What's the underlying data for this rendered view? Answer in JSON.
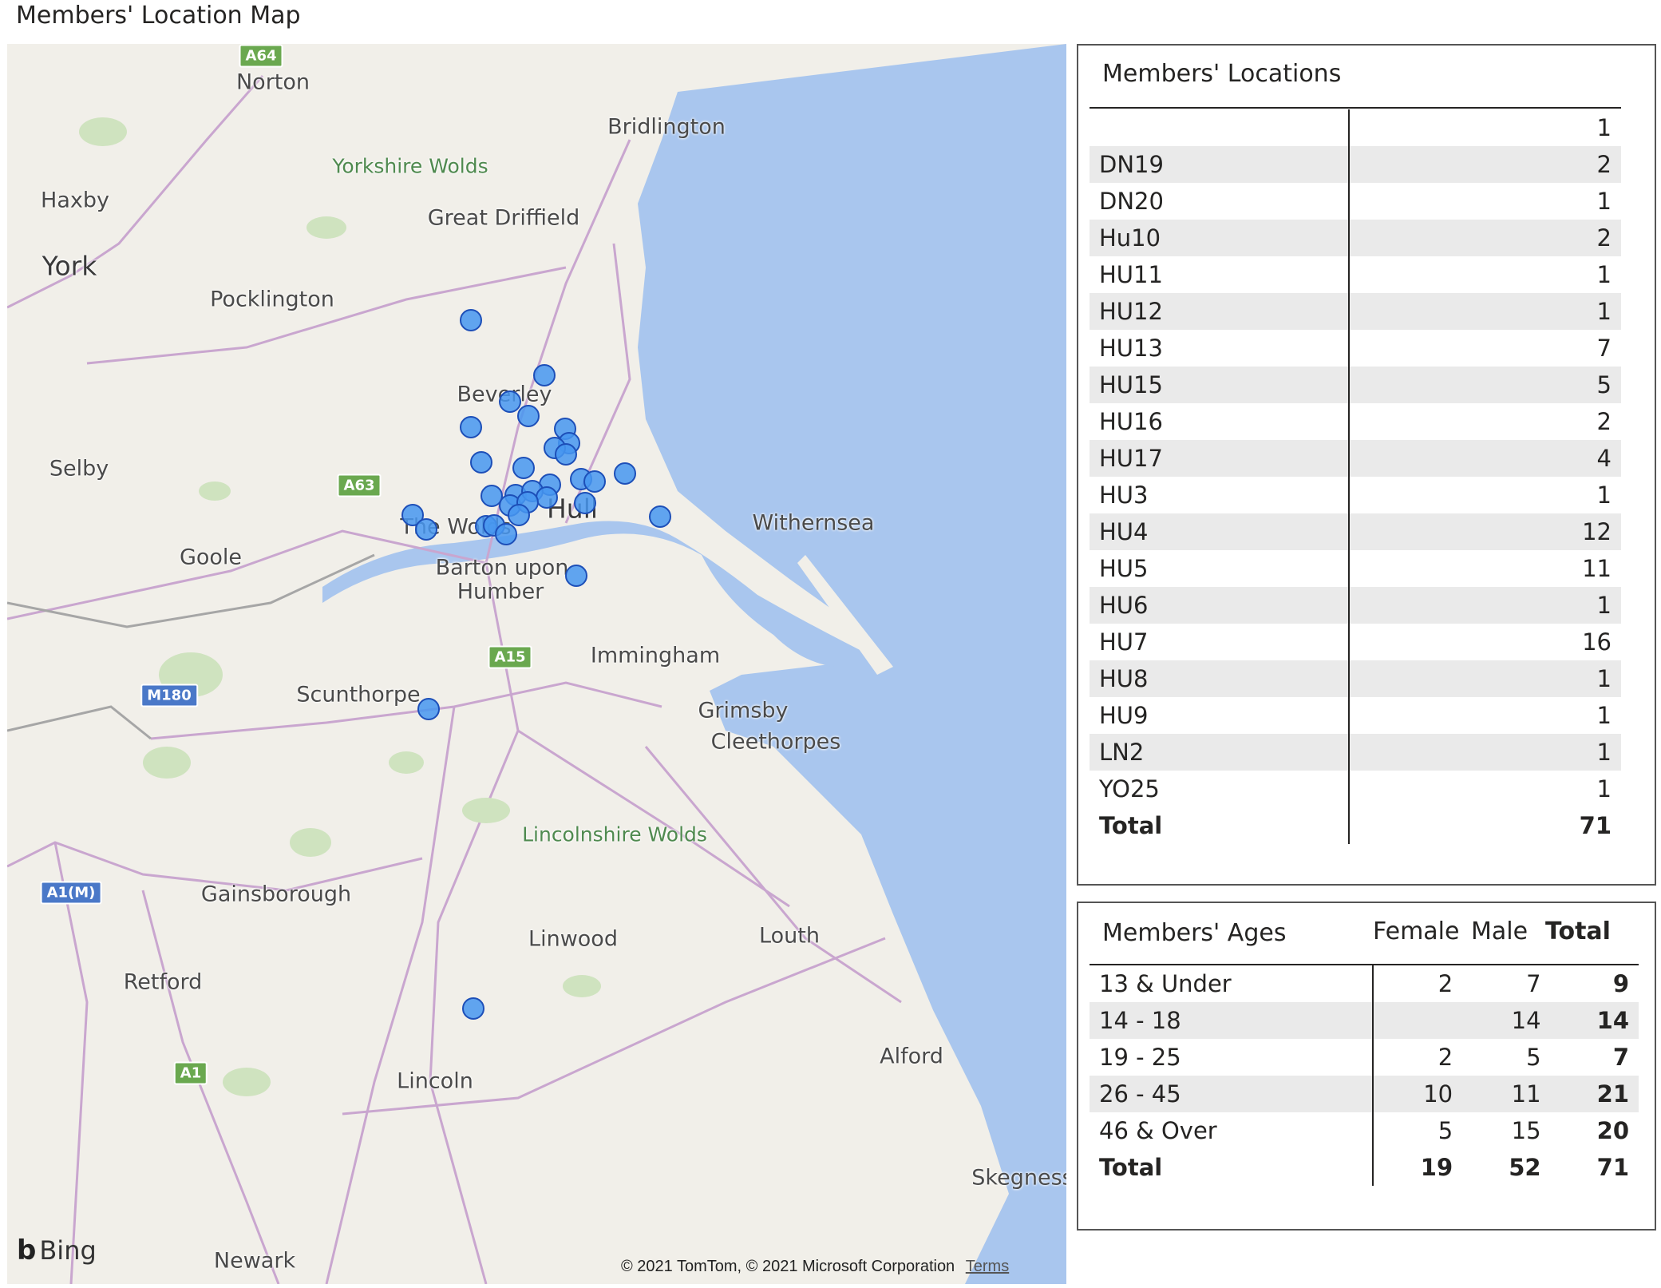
{
  "page_title": "Members' Location Map",
  "map": {
    "places": [
      "Norton",
      "Bridlington",
      "Yorkshire Wolds",
      "Haxby",
      "Great Driffield",
      "York",
      "Pocklington",
      "Beverley",
      "Selby",
      "Hull",
      "The Wolds",
      "Withernsea",
      "Goole",
      "Barton upon",
      "Humber",
      "Immingham",
      "Scunthorpe",
      "Grimsby",
      "Cleethorpes",
      "Lincolnshire Wolds",
      "Gainsborough",
      "Linwood",
      "Louth",
      "Retford",
      "Alford",
      "Lincoln",
      "Skegness",
      "Newark"
    ],
    "roads": [
      "A64",
      "A63",
      "A15",
      "M180",
      "A1(M)",
      "A1"
    ],
    "attribution_logo": "Bing",
    "copyright": "© 2021 TomTom, © 2021 Microsoft Corporation",
    "terms_link": "Terms",
    "marker_count_label": "",
    "colors": {
      "water": "#a9c6ee",
      "land": "#f1efe9",
      "marker": "#4696f0",
      "marker_border": "#1d4fb8"
    }
  },
  "locations_table": {
    "title": "Members' Locations",
    "rows": [
      {
        "code": "",
        "count": "1"
      },
      {
        "code": "DN19",
        "count": "2"
      },
      {
        "code": "DN20",
        "count": "1"
      },
      {
        "code": "Hu10",
        "count": "2"
      },
      {
        "code": "HU11",
        "count": "1"
      },
      {
        "code": "HU12",
        "count": "1"
      },
      {
        "code": "HU13",
        "count": "7"
      },
      {
        "code": "HU15",
        "count": "5"
      },
      {
        "code": "HU16",
        "count": "2"
      },
      {
        "code": "HU17",
        "count": "4"
      },
      {
        "code": "HU3",
        "count": "1"
      },
      {
        "code": "HU4",
        "count": "12"
      },
      {
        "code": "HU5",
        "count": "11"
      },
      {
        "code": "HU6",
        "count": "1"
      },
      {
        "code": "HU7",
        "count": "16"
      },
      {
        "code": "HU8",
        "count": "1"
      },
      {
        "code": "HU9",
        "count": "1"
      },
      {
        "code": "LN2",
        "count": "1"
      },
      {
        "code": "YO25",
        "count": "1"
      }
    ],
    "total_label": "Total",
    "total_value": "71"
  },
  "ages_table": {
    "title": "Members' Ages",
    "headers": [
      "Female",
      "Male",
      "Total"
    ],
    "rows": [
      {
        "label": "13 & Under",
        "female": "2",
        "male": "7",
        "total": "9"
      },
      {
        "label": "14 - 18",
        "female": "",
        "male": "14",
        "total": "14"
      },
      {
        "label": "19 - 25",
        "female": "2",
        "male": "5",
        "total": "7"
      },
      {
        "label": "26 - 45",
        "female": "10",
        "male": "11",
        "total": "21"
      },
      {
        "label": "46 & Over",
        "female": "5",
        "male": "15",
        "total": "20"
      }
    ],
    "total": {
      "label": "Total",
      "female": "19",
      "male": "52",
      "total": "71"
    }
  }
}
